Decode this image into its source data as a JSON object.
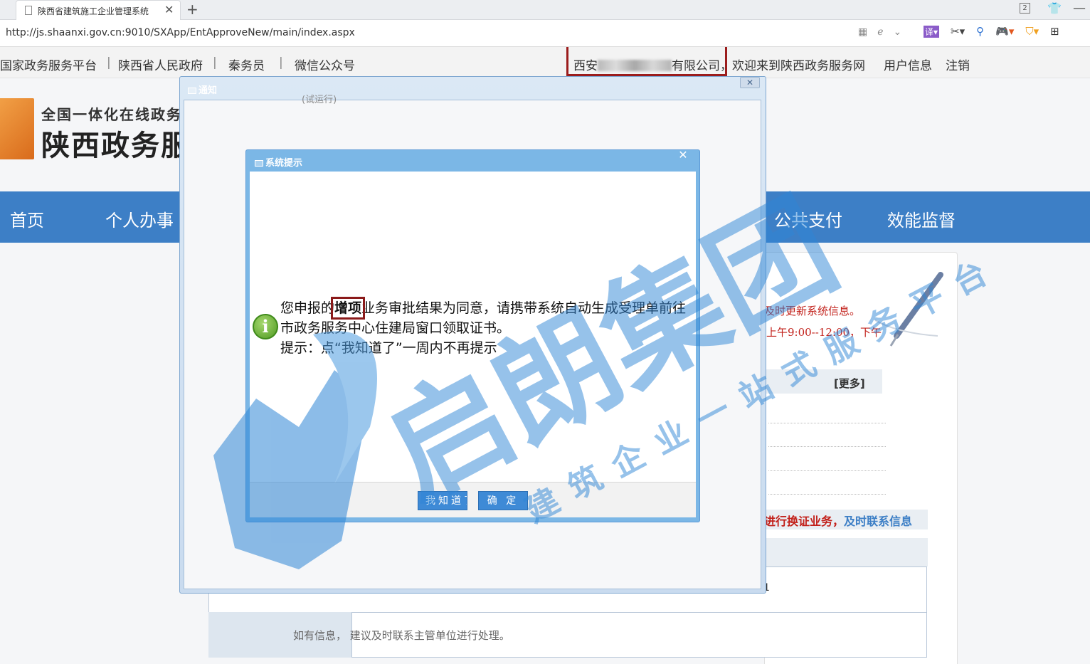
{
  "browser": {
    "tab_title": "陕西省建筑施工企业管理系统",
    "tab_close": "✕",
    "new_tab": "+",
    "tab_count": "2",
    "url": "http://js.shaanxi.gov.cn:9010/SXApp/EntApproveNew/main/index.aspx",
    "toolbar_icons": [
      "grid-icon",
      "ie-icon",
      "chevron-down-icon",
      "translate-icon",
      "scissors-icon",
      "search-icon",
      "game-icon",
      "wallet-icon",
      "apps-icon"
    ]
  },
  "header": {
    "links": [
      "国家政务服务平台",
      "陕西省人民政府",
      "秦务员",
      "微信公众号"
    ],
    "separator": "|",
    "company_prefix": "西安",
    "company_suffix": "有限公司",
    "welcome": "，欢迎来到陕西政务服务网",
    "user_info": "用户信息",
    "logout": "注销"
  },
  "logo": {
    "subtitle": "全国一体化在线政务服务平台",
    "title": "陕西政务服务网"
  },
  "nav": {
    "items": [
      "首页",
      "个人办事",
      "公共支付",
      "效能监督"
    ]
  },
  "content": {
    "notice_line1": "及时更新系统信息。",
    "notice_line2": "上午9:00--12:00，下午",
    "more": "[更多]",
    "renew_red": "进行换证业务，",
    "renew_blue": "及时联系信息",
    "digit": "1",
    "bottom_text": "如有信息，  建议及时联系主管单位进行处理。"
  },
  "dialog_outer": {
    "title": "通知",
    "close": "✕",
    "trial": "(试运行)"
  },
  "dialog_inner": {
    "title": "系统提示",
    "close": "✕",
    "message_pre": "您申报的",
    "message_highlight": "增项",
    "message_post": "业务审批结果为同意，请携带系统自动生成受理单前往市政务服务中心住建局窗口领取证书。",
    "tip": "提示：点“我知道了”一周内不再提示",
    "btn_know": "我知道了",
    "btn_ok": "确 定",
    "icon": "info-icon"
  },
  "watermark": {
    "brand": "启朗集团",
    "slogan": "建筑企业一站式服务平台",
    "color": "#2f86d6"
  }
}
